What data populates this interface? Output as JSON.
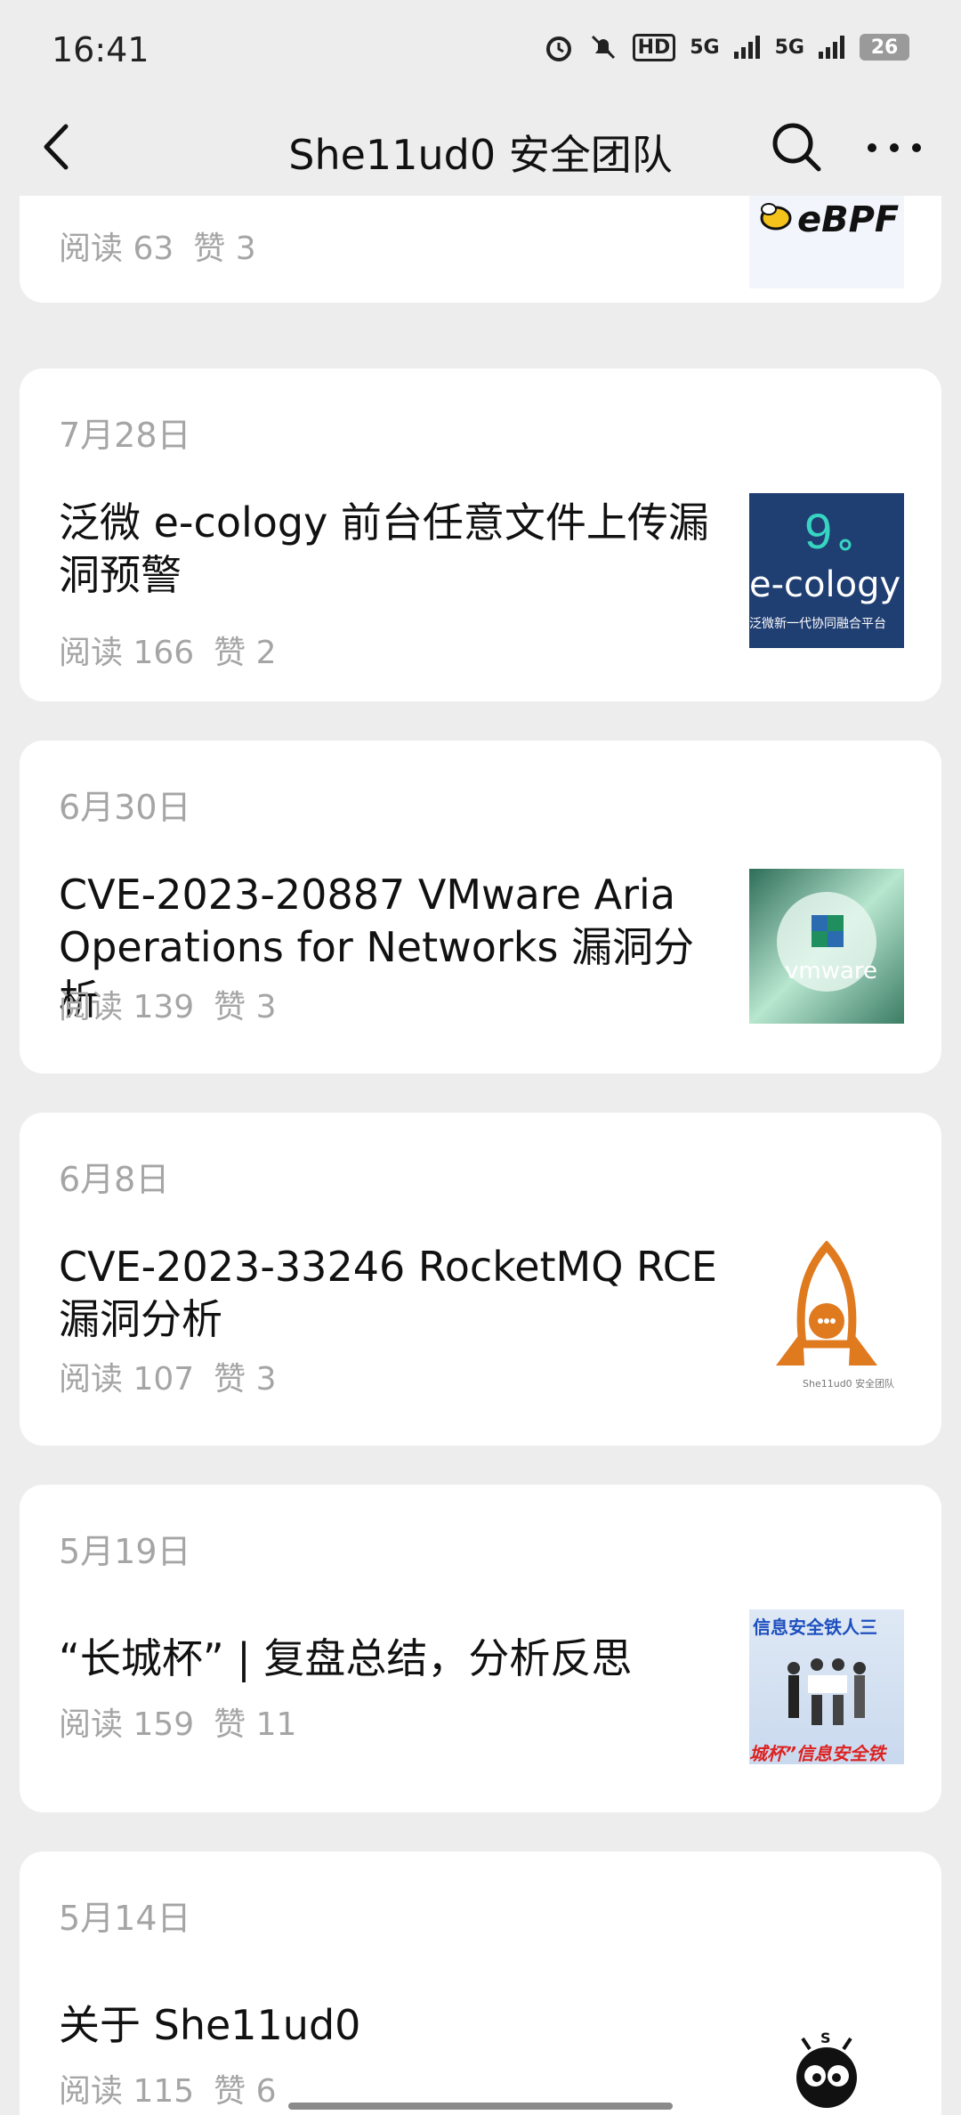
{
  "status_bar": {
    "time": "16:41",
    "signal1": "5G",
    "signal2": "5G",
    "hd": "HD",
    "battery": "26"
  },
  "nav": {
    "title": "She11ud0 安全团队"
  },
  "articles": [
    {
      "date": "",
      "title": "",
      "reads": "阅读 63",
      "likes": "赞 3",
      "thumb_text": "eBPF"
    },
    {
      "date": "7月28日",
      "title": "泛微 e-cology 前台任意文件上传漏洞预警",
      "reads": "阅读 166",
      "likes": "赞 2",
      "thumb_text": "e-cology",
      "thumb_sub": "泛微新一代协同融合平台"
    },
    {
      "date": "6月30日",
      "title": "CVE-2023-20887 VMware Aria Operations for Networks 漏洞分析",
      "reads": "阅读 139",
      "likes": "赞 3",
      "thumb_text": "vmware"
    },
    {
      "date": "6月8日",
      "title": "CVE-2023-33246 RocketMQ RCE 漏洞分析",
      "reads": "阅读 107",
      "likes": "赞 3",
      "thumb_text": "She11ud0 安全团队"
    },
    {
      "date": "5月19日",
      "title": "“长城杯” | 复盘总结，分析反思",
      "reads": "阅读 159",
      "likes": "赞 11",
      "thumb_text": "信息安全铁人三",
      "thumb_sub": "城杯”信息安全铁"
    },
    {
      "date": "5月14日",
      "title": "关于 She11ud0",
      "reads": "阅读 115",
      "likes": "赞 6",
      "thumb_text": "S"
    }
  ]
}
